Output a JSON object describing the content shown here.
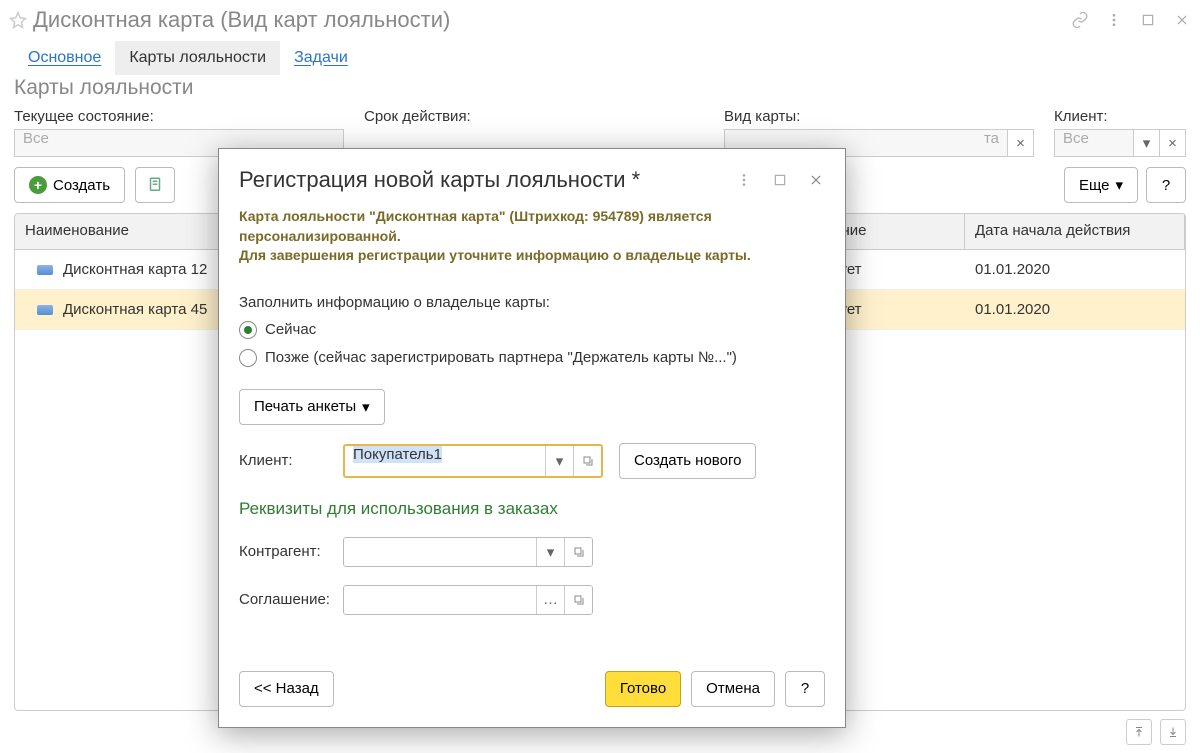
{
  "window": {
    "title": "Дисконтная карта (Вид карт лояльности)"
  },
  "tabs": {
    "main": "Основное",
    "loyalty": "Карты лояльности",
    "tasks": "Задачи"
  },
  "page_header": "Карты лояльности",
  "filters": {
    "state": {
      "label": "Текущее состояние:",
      "value": "Все"
    },
    "validity": {
      "label": "Срок действия:"
    },
    "card_type": {
      "label": "Вид карты:",
      "value": "та"
    },
    "client": {
      "label": "Клиент:",
      "value": "Все"
    }
  },
  "toolbar": {
    "create": "Создать",
    "more": "Еще",
    "help": "?"
  },
  "table": {
    "headers": {
      "name": "Наименование",
      "status": "ояние",
      "date": "Дата начала действия"
    },
    "rows": [
      {
        "name": "Дисконтная карта 12",
        "status": "твует",
        "date": "01.01.2020",
        "selected": false
      },
      {
        "name": "Дисконтная карта 45",
        "status": "твует",
        "date": "01.01.2020",
        "selected": true
      }
    ]
  },
  "modal": {
    "title": "Регистрация новой карты лояльности *",
    "info_line1": "Карта лояльности \"Дисконтная карта\" (Штрихкод: 954789) является персонализированной.",
    "info_line2": "Для завершения регистрации уточните информацию о владельце карты.",
    "fill_prompt": "Заполнить информацию о владельце карты:",
    "radio_now": "Сейчас",
    "radio_later": "Позже (сейчас зарегистрировать партнера \"Держатель карты №...\")",
    "print_survey": "Печать анкеты",
    "client_label": "Клиент:",
    "client_value": "Покупатель1",
    "create_new": "Создать нового",
    "requisites_header": "Реквизиты для использования в заказах",
    "counterparty_label": "Контрагент:",
    "agreement_label": "Соглашение:",
    "back": "<< Назад",
    "done": "Готово",
    "cancel": "Отмена",
    "help": "?"
  }
}
